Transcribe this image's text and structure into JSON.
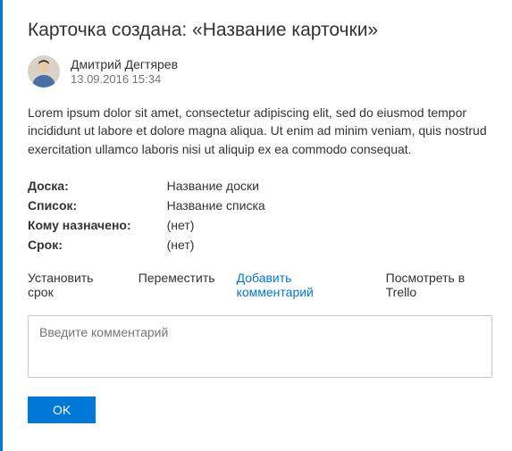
{
  "title": "Карточка создана: «Название карточки»",
  "author": {
    "name": "Дмитрий Дегтярев",
    "timestamp": "13.09.2016 15:34"
  },
  "description": "Lorem ipsum dolor sit amet, consectetur adipiscing elit, sed do eiusmod tempor incididunt ut labore et dolore magna aliqua. Ut enim ad minim veniam, quis nostrud exercitation ullamco laboris nisi ut aliquip ex ea commodo consequat.",
  "fields": {
    "board": {
      "label": "Доска:",
      "value": "Название доски"
    },
    "list": {
      "label": "Список:",
      "value": "Название списка"
    },
    "assigned": {
      "label": "Кому назначено:",
      "value": "(нет)"
    },
    "due": {
      "label": "Срок:",
      "value": "(нет)"
    }
  },
  "actions": {
    "set_due": "Установить срок",
    "move": "Переместить",
    "add_comment": "Добавить комментарий",
    "view_trello": "Посмотреть в Trello"
  },
  "comment": {
    "placeholder": "Введите комментарий",
    "submit_label": "OK"
  },
  "colors": {
    "accent": "#0078d7"
  }
}
